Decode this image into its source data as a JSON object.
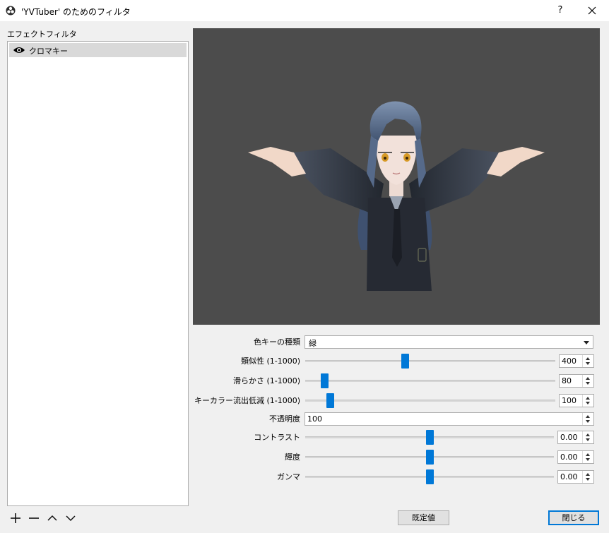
{
  "window": {
    "title": "'YVTuber' のためのフィルタ",
    "help_label": "?"
  },
  "sidebar": {
    "label": "エフェクトフィルタ",
    "filters": [
      {
        "name": "クロマキー",
        "visible": true
      }
    ]
  },
  "settings": {
    "key_color_type": {
      "label": "色キーの種類",
      "value": "緑"
    },
    "similarity": {
      "label": "類似性 (1-1000)",
      "value": "400",
      "min": 1,
      "max": 1000,
      "level": 400
    },
    "smoothness": {
      "label": "滑らかさ (1-1000)",
      "value": "80",
      "min": 1,
      "max": 1000,
      "level": 80
    },
    "spill": {
      "label": "キーカラー流出低減 (1-1000)",
      "value": "100",
      "min": 1,
      "max": 1000,
      "level": 100
    },
    "opacity": {
      "label": "不透明度",
      "value": "100"
    },
    "contrast": {
      "label": "コントラスト",
      "value": "0.00",
      "min": -1,
      "max": 1,
      "level": 0
    },
    "brightness": {
      "label": "輝度",
      "value": "0.00",
      "min": -1,
      "max": 1,
      "level": 0
    },
    "gamma": {
      "label": "ガンマ",
      "value": "0.00",
      "min": -1,
      "max": 1,
      "level": 0
    }
  },
  "buttons": {
    "defaults": "既定値",
    "close": "閉じる"
  },
  "colors": {
    "accent": "#0078d7",
    "preview_bg": "#4c4c4c"
  }
}
